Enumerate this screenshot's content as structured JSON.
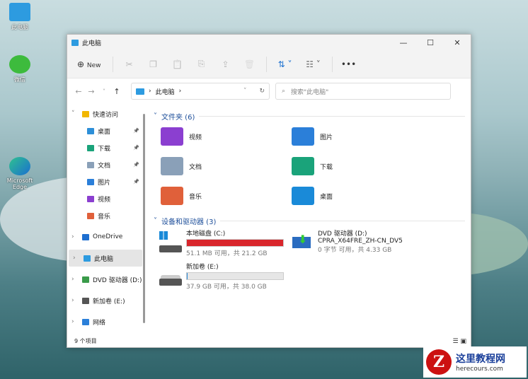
{
  "desktop": {
    "icons": [
      {
        "label": "此电脑"
      },
      {
        "label": "微信"
      },
      {
        "label": "Microsoft Edge"
      }
    ]
  },
  "window": {
    "title": "此电脑",
    "controls": {
      "minimize": "—",
      "maximize": "☐",
      "close": "✕"
    }
  },
  "toolbar": {
    "new_label": "New",
    "new_icon": "⊕",
    "cut": "✂",
    "copy": "❐",
    "paste": "📋",
    "rename": "⎘",
    "share": "⇪",
    "delete": "🗑",
    "sort": "⇅ ˅",
    "view": "☷ ˅",
    "more": "•••"
  },
  "address": {
    "back": "←",
    "forward": "→",
    "recent": "˅",
    "up": "↑",
    "path": "此电脑",
    "sep": "›",
    "dropdown": "˅",
    "refresh": "↻",
    "search_placeholder": "搜索\"此电脑\"",
    "search_icon": "⌕"
  },
  "sidebar": {
    "items": [
      {
        "label": "快速访问",
        "chev": "˅",
        "color": "#f2b700"
      },
      {
        "label": "桌面",
        "color": "#2d8fd8",
        "pin": "📌"
      },
      {
        "label": "下载",
        "color": "#1aa37a",
        "pin": "📌"
      },
      {
        "label": "文档",
        "color": "#8aa0b8",
        "pin": "📌"
      },
      {
        "label": "图片",
        "color": "#2b7fd9",
        "pin": "📌"
      },
      {
        "label": "视频",
        "color": "#8b3fd0"
      },
      {
        "label": "音乐",
        "color": "#e0603a"
      },
      {
        "label": "OneDrive",
        "chev": "›",
        "color": "#1e6fd0"
      },
      {
        "label": "此电脑",
        "chev": "›",
        "color": "#2d9be0"
      },
      {
        "label": "DVD 驱动器 (D:)",
        "chev": "›",
        "color": "#3a9b4a"
      },
      {
        "label": "新加卷 (E:)",
        "chev": "›",
        "color": "#555"
      },
      {
        "label": "网络",
        "chev": "›",
        "color": "#2b7fd9"
      }
    ]
  },
  "folders": {
    "header": "文件夹 (6)",
    "items": [
      {
        "label": "视频",
        "color": "#8b3fd0"
      },
      {
        "label": "图片",
        "color": "#2b7fd9"
      },
      {
        "label": "文档",
        "color": "#8aa0b8"
      },
      {
        "label": "下载",
        "color": "#1aa37a"
      },
      {
        "label": "音乐",
        "color": "#e0603a"
      },
      {
        "label": "桌面",
        "color": "#1a8ad8"
      }
    ]
  },
  "drives": {
    "header": "设备和驱动器 (3)",
    "items": [
      {
        "label": "本地磁盘 (C:)",
        "usage": 0.998,
        "bar_color": "#d9262c",
        "sub": "51.1 MB 可用，共 21.2 GB"
      },
      {
        "label": "DVD 驱动器 (D:)",
        "volume": "CPRA_X64FRE_ZH-CN_DV5",
        "sub": "0 字节 可用，共 4.33 GB"
      },
      {
        "label": "新加卷 (E:)",
        "usage": 0.003,
        "bar_color": "#2a8ad8",
        "sub": "37.9 GB 可用，共 38.0 GB"
      }
    ]
  },
  "status": {
    "count": "9 个项目",
    "details_icon": "☰",
    "tiles_icon": "▣"
  },
  "watermark": {
    "site": "这里教程网",
    "url": "herecours.com"
  }
}
